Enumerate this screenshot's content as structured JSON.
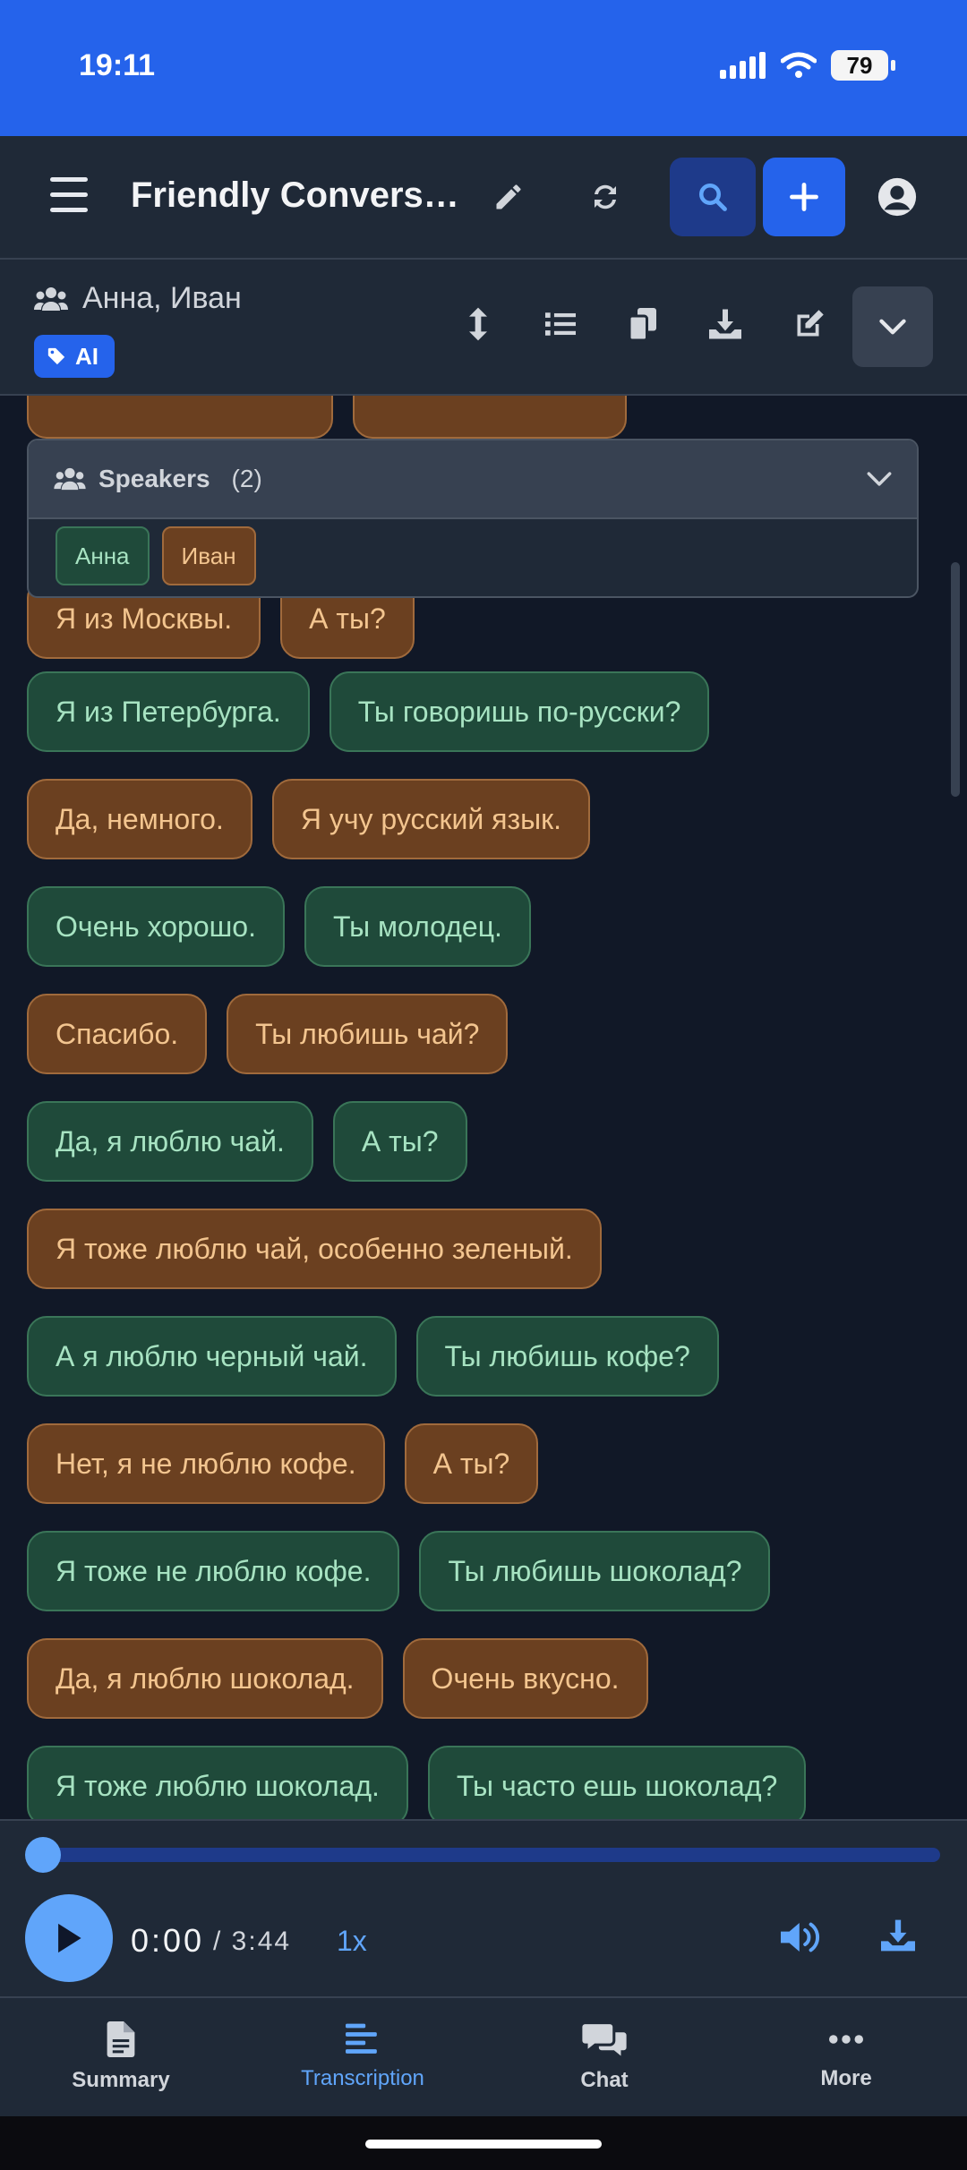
{
  "status": {
    "time": "19:11",
    "battery": "79"
  },
  "header": {
    "title": "Friendly Conversat..."
  },
  "subheader": {
    "participants": "Анна, Иван",
    "tag": "AI"
  },
  "speakers": {
    "title": "Speakers",
    "count": "(2)",
    "chips": [
      "Анна",
      "Иван"
    ]
  },
  "transcript": {
    "rows": [
      {
        "items": [
          {
            "text": "",
            "speaker": "brown"
          },
          {
            "text": "",
            "speaker": "brown"
          }
        ]
      },
      {
        "items": [
          {
            "text": "Я из Москвы.",
            "speaker": "brown"
          },
          {
            "text": "А ты?",
            "speaker": "brown"
          }
        ]
      },
      {
        "items": [
          {
            "text": "Я из Петербурга.",
            "speaker": "green"
          },
          {
            "text": "Ты говоришь по-русски?",
            "speaker": "green"
          }
        ]
      },
      {
        "items": [
          {
            "text": "Да, немного.",
            "speaker": "brown"
          },
          {
            "text": "Я учу русский язык.",
            "speaker": "brown"
          }
        ]
      },
      {
        "items": [
          {
            "text": "Очень хорошо.",
            "speaker": "green"
          },
          {
            "text": "Ты молодец.",
            "speaker": "green"
          }
        ]
      },
      {
        "items": [
          {
            "text": "Спасибо.",
            "speaker": "brown"
          },
          {
            "text": "Ты любишь чай?",
            "speaker": "brown"
          }
        ]
      },
      {
        "items": [
          {
            "text": "Да, я люблю чай.",
            "speaker": "green"
          },
          {
            "text": "А ты?",
            "speaker": "green"
          }
        ]
      },
      {
        "items": [
          {
            "text": "Я тоже люблю чай, особенно зеленый.",
            "speaker": "brown"
          }
        ]
      },
      {
        "items": [
          {
            "text": "А я люблю черный чай.",
            "speaker": "green"
          },
          {
            "text": "Ты любишь кофе?",
            "speaker": "green"
          }
        ]
      },
      {
        "items": [
          {
            "text": "Нет, я не люблю кофе.",
            "speaker": "brown"
          },
          {
            "text": "А ты?",
            "speaker": "brown"
          }
        ]
      },
      {
        "items": [
          {
            "text": "Я тоже не люблю кофе.",
            "speaker": "green"
          },
          {
            "text": "Ты любишь шоколад?",
            "speaker": "green"
          }
        ]
      },
      {
        "items": [
          {
            "text": "Да, я люблю шоколад.",
            "speaker": "brown"
          },
          {
            "text": "Очень вкусно.",
            "speaker": "brown"
          }
        ]
      },
      {
        "items": [
          {
            "text": "Я тоже люблю шоколад.",
            "speaker": "green"
          },
          {
            "text": "Ты часто ешь шоколад?",
            "speaker": "green"
          }
        ]
      }
    ]
  },
  "player": {
    "current": "0:00",
    "duration": "/ 3:44",
    "speed": "1x",
    "progress": 0
  },
  "nav": {
    "summary": "Summary",
    "transcription": "Transcription",
    "chat": "Chat",
    "more": "More",
    "active": "transcription"
  },
  "colors": {
    "accent": "#2563eb",
    "speaker_anna": "#1f4a3a",
    "speaker_ivan": "#6b4020"
  }
}
